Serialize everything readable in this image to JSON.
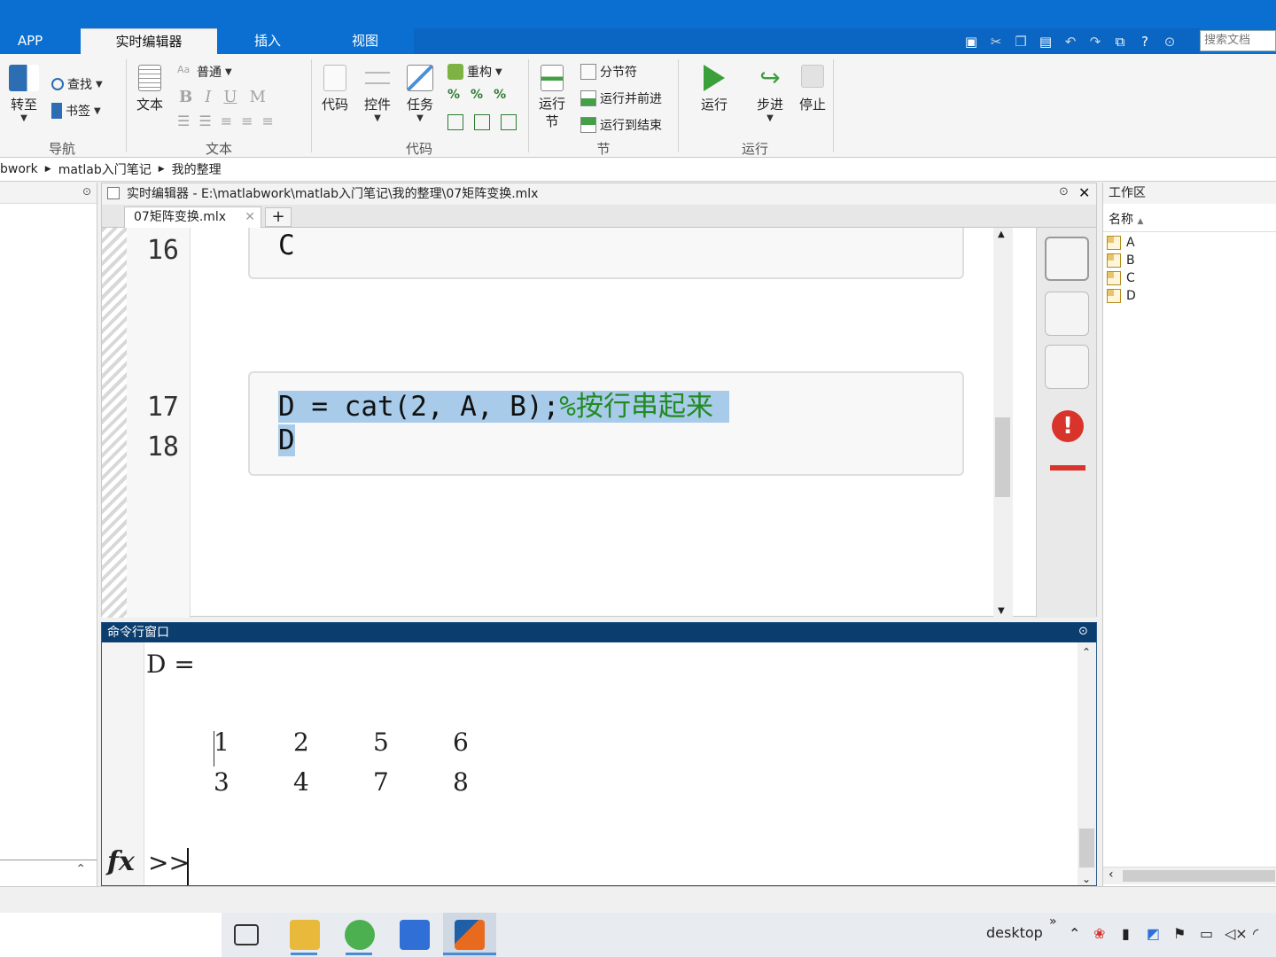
{
  "ribbon_tabs": [
    {
      "label": "APP"
    },
    {
      "label": "实时编辑器"
    },
    {
      "label": "插入"
    },
    {
      "label": "视图"
    }
  ],
  "search_placeholder": "搜索文档",
  "ribbon": {
    "nav": {
      "goto": "转至",
      "find": "查找",
      "bookmark": "书签",
      "group": "导航"
    },
    "text": {
      "text_btn": "文本",
      "style": "普通",
      "bold": "B",
      "italic": "I",
      "underline": "U",
      "mono": "M",
      "group": "文本"
    },
    "code": {
      "code_btn": "代码",
      "control_btn": "控件",
      "task_btn": "任务",
      "refactor": "重构",
      "group": "代码"
    },
    "section": {
      "run_section": "运行节",
      "section_break": "分节符",
      "run_advance": "运行并前进",
      "run_to_end": "运行到结束",
      "group": "节"
    },
    "run": {
      "run": "运行",
      "step": "步进",
      "stop": "停止",
      "group": "运行"
    }
  },
  "breadcrumb": [
    "bwork",
    "matlab入门笔记",
    "我的整理"
  ],
  "editor": {
    "title": "实时编辑器 - E:\\matlabwork\\matlab入门笔记\\我的整理\\07矩阵变换.mlx",
    "tab": "07矩阵变换.mlx",
    "lines": [
      {
        "num": "16",
        "code": "C",
        "comment": ""
      },
      {
        "num": "17",
        "code": "D = cat(2, A, B);",
        "comment": "%按行串起来"
      },
      {
        "num": "18",
        "code": "D",
        "comment": ""
      }
    ]
  },
  "command_window": {
    "title": "命令行窗口",
    "output_header": "D =",
    "matrix": [
      [
        "1",
        "2",
        "5",
        "6"
      ],
      [
        "3",
        "4",
        "7",
        "8"
      ]
    ],
    "prompt": ">>",
    "fx": "fx"
  },
  "workspace": {
    "title": "工作区",
    "column": "名称",
    "vars": [
      "A",
      "B",
      "C",
      "D"
    ]
  },
  "taskbar": {
    "desktop_label": "desktop",
    "chevron": "»"
  },
  "colors": {
    "accent": "#0a6fd0",
    "selection": "#a8cbea",
    "comment": "#228B22",
    "error": "#d9342b"
  }
}
